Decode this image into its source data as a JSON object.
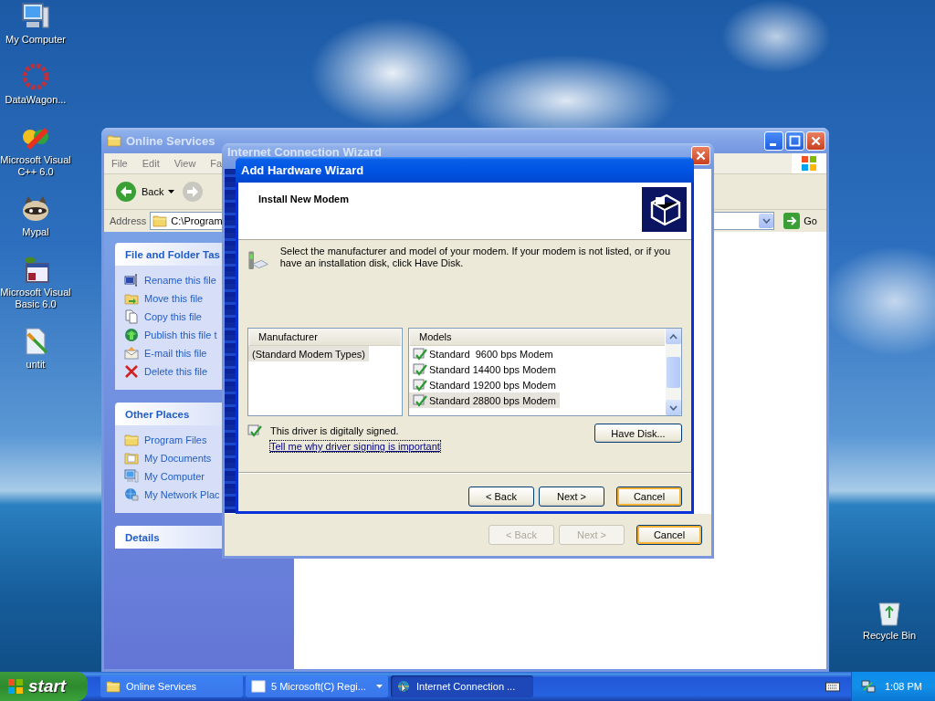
{
  "desktop_icons": [
    {
      "label": "My Computer",
      "kind": "computer"
    },
    {
      "label": "DataWagon...",
      "kind": "ring"
    },
    {
      "label": "Microsoft Visual C++ 6.0",
      "kind": "pinwheel"
    },
    {
      "label": "Mypal",
      "kind": "raccoon"
    },
    {
      "label": "Microsoft Visual Basic 6.0",
      "kind": "vb"
    },
    {
      "label": "untit",
      "kind": "brush-document"
    }
  ],
  "recycle_bin": {
    "label": "Recycle Bin"
  },
  "explorer": {
    "title": "Online Services",
    "active": false,
    "menu": [
      "File",
      "Edit",
      "View",
      "Fa"
    ],
    "back_label": "Back",
    "address": {
      "label": "Address",
      "value": "C:\\Program",
      "go": "Go"
    },
    "panels": [
      {
        "title": "File and Folder Tas",
        "items": [
          {
            "label": "Rename this file"
          },
          {
            "label": "Move this file"
          },
          {
            "label": "Copy this file"
          },
          {
            "label": "Publish this file t"
          },
          {
            "label": "E-mail this file"
          },
          {
            "label": "Delete this file"
          }
        ]
      },
      {
        "title": "Other Places",
        "items": [
          {
            "label": "Program Files"
          },
          {
            "label": "My Documents"
          },
          {
            "label": "My Computer"
          },
          {
            "label": "My Network Plac"
          }
        ]
      },
      {
        "title": "Details"
      }
    ]
  },
  "connection_wizard": {
    "title": "Internet Connection Wizard",
    "active": false,
    "buttons": [
      {
        "label": "< Back",
        "disabled": true,
        "focused": false
      },
      {
        "label": "Next >",
        "disabled": true,
        "focused": false
      },
      {
        "label": "Cancel",
        "disabled": false,
        "focused": true
      }
    ]
  },
  "hardware_wizard": {
    "title": "Add Hardware Wizard",
    "active": true,
    "heading": "Install New Modem",
    "description": "Select the manufacturer and model of your modem. If your modem is not listed, or if you have an installation disk, click Have Disk.",
    "manufacturers": {
      "header": "Manufacturer",
      "items": [
        {
          "label": "(Standard Modem Types)",
          "selected": true
        }
      ]
    },
    "models": {
      "header": "Models",
      "items": [
        {
          "label": "Standard  9600 bps Modem",
          "selected": false
        },
        {
          "label": "Standard 14400 bps Modem",
          "selected": false
        },
        {
          "label": "Standard 19200 bps Modem",
          "selected": false
        },
        {
          "label": "Standard 28800 bps Modem",
          "selected": true
        }
      ]
    },
    "signed_note": "This driver is digitally signed.",
    "link": "Tell me why driver signing is important",
    "have_disk": "Have Disk...",
    "buttons": [
      {
        "label": "< Back",
        "disabled": false,
        "focused": false
      },
      {
        "label": "Next >",
        "disabled": false,
        "focused": false
      },
      {
        "label": "Cancel",
        "disabled": false,
        "focused": true
      }
    ]
  },
  "taskbar": {
    "start": "start",
    "tasks": [
      {
        "label": "Online Services",
        "selected": false,
        "group": false
      },
      {
        "label": "5 Microsoft(C) Regi...",
        "selected": false,
        "group": true
      },
      {
        "label": "Internet Connection ...",
        "selected": true,
        "group": false
      }
    ],
    "clock": "1:08 PM"
  }
}
